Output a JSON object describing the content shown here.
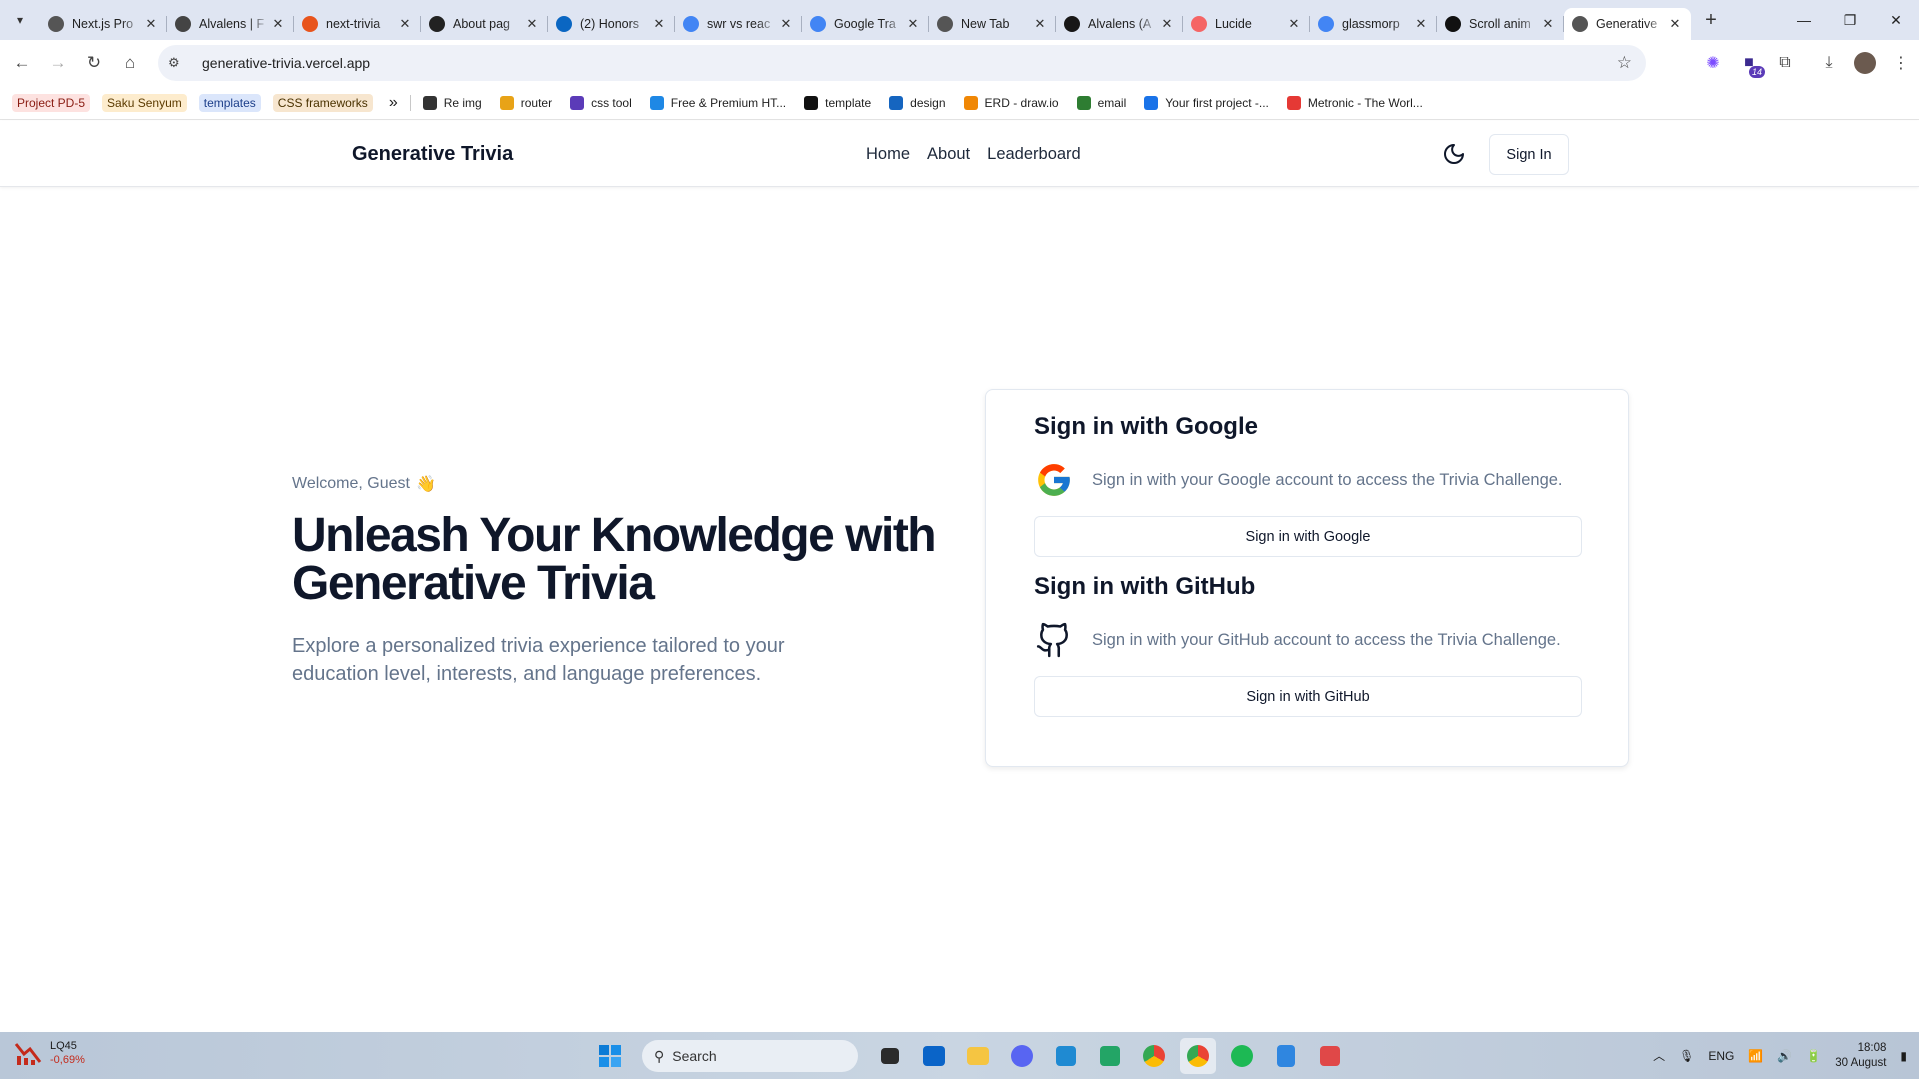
{
  "browser": {
    "tabs": [
      {
        "title": "Next.js Pro",
        "favicon_color": "#555555"
      },
      {
        "title": "Alvalens | F",
        "favicon_color": "#444444"
      },
      {
        "title": "next-trivia",
        "favicon_color": "#e8541c"
      },
      {
        "title": "About pag",
        "favicon_color": "#222222"
      },
      {
        "title": "(2) Honors",
        "favicon_color": "#0a66c2"
      },
      {
        "title": "swr vs reac",
        "favicon_color": "#4285f4"
      },
      {
        "title": "Google Tra",
        "favicon_color": "#4285f4"
      },
      {
        "title": "New Tab",
        "favicon_color": "#555555"
      },
      {
        "title": "Alvalens (A",
        "favicon_color": "#181717"
      },
      {
        "title": "Lucide",
        "favicon_color": "#f56565"
      },
      {
        "title": "glassmorp",
        "favicon_color": "#4285f4"
      },
      {
        "title": "Scroll anim",
        "favicon_color": "#111111"
      },
      {
        "title": "Generative",
        "favicon_color": "#555555",
        "active": true
      }
    ],
    "url": "generative-trivia.vercel.app",
    "extension_badge": "14",
    "bookmark_chips": [
      {
        "label": "Project PD-5",
        "bg": "#fde2e0",
        "color": "#8a1c12"
      },
      {
        "label": "Saku Senyum",
        "bg": "#fdeccd",
        "color": "#5b3a00"
      },
      {
        "label": "templates",
        "bg": "#dbe6fb",
        "color": "#1d3f8a"
      },
      {
        "label": "CSS frameworks",
        "bg": "#f7e6cf",
        "color": "#4a3200"
      }
    ],
    "bookmarks": [
      {
        "label": "Re img",
        "icon_color": "#333333"
      },
      {
        "label": "router",
        "icon_color": "#e8a317"
      },
      {
        "label": "css tool",
        "icon_color": "#5b3bb8"
      },
      {
        "label": "Free & Premium HT...",
        "icon_color": "#1e88e5"
      },
      {
        "label": "template",
        "icon_color": "#111111"
      },
      {
        "label": "design",
        "icon_color": "#1565c0"
      },
      {
        "label": "ERD - draw.io",
        "icon_color": "#f08705"
      },
      {
        "label": "email",
        "icon_color": "#2e7d32"
      },
      {
        "label": "Your first project -...",
        "icon_color": "#1a73e8"
      },
      {
        "label": "Metronic - The Worl...",
        "icon_color": "#e53935"
      }
    ]
  },
  "site": {
    "brand": "Generative Trivia",
    "nav": [
      "Home",
      "About",
      "Leaderboard"
    ],
    "sign_in_label": "Sign In",
    "theme_icon": "moon-icon"
  },
  "hero": {
    "welcome": "Welcome, Guest",
    "wave_emoji": "👋",
    "headline": "Unleash Your Knowledge with Generative Trivia",
    "subtitle": "Explore a personalized trivia experience tailored to your education level, interests, and language preferences."
  },
  "auth_card": {
    "google": {
      "title": "Sign in with Google",
      "description": "Sign in with your Google account to access the Trivia Challenge.",
      "button": "Sign in with Google"
    },
    "github": {
      "title": "Sign in with GitHub",
      "description": "Sign in with your GitHub account to access the Trivia Challenge.",
      "button": "Sign in with GitHub"
    }
  },
  "taskbar": {
    "weather_name": "LQ45",
    "weather_change": "-0,69%",
    "search_placeholder": "Search",
    "language": "ENG",
    "time": "18:08",
    "date": "30 August"
  }
}
